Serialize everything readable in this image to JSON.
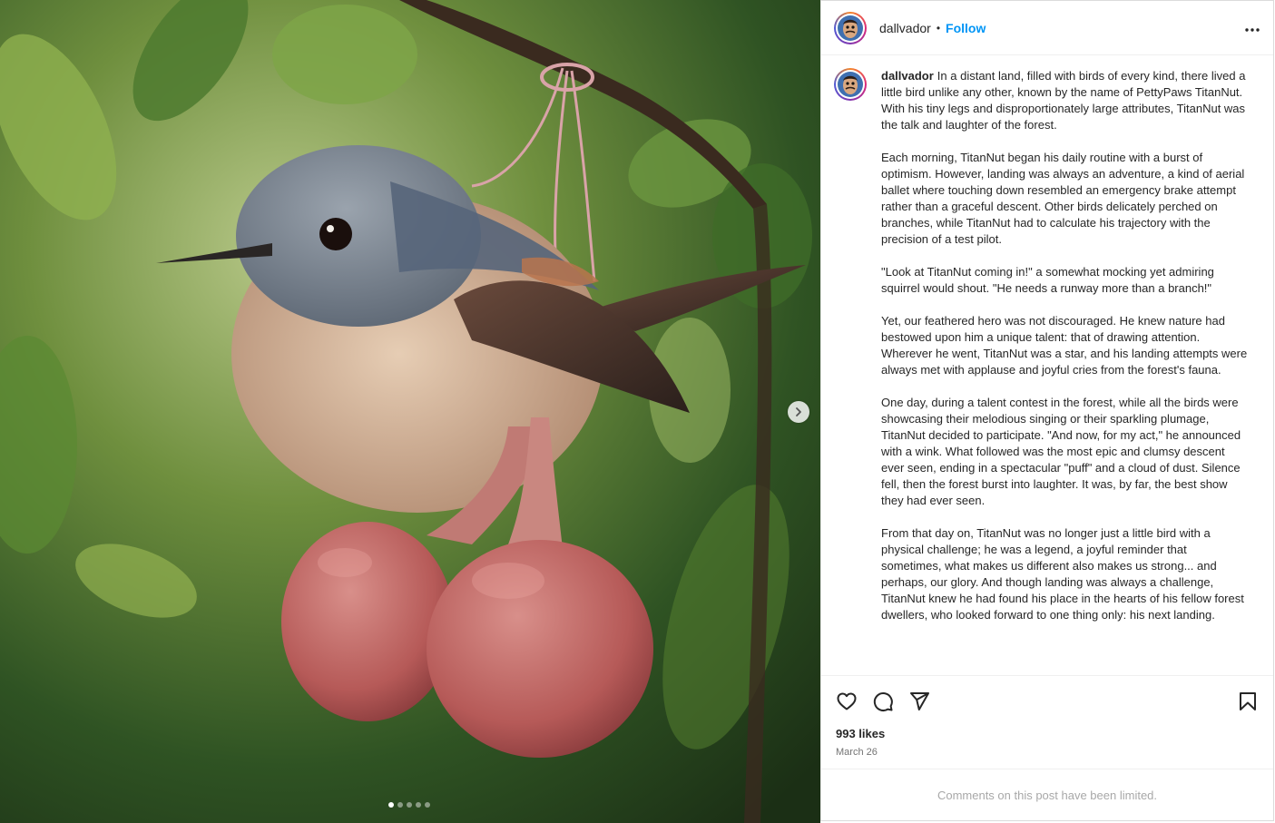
{
  "post": {
    "username": "dallvador",
    "separator": "•",
    "follow_label": "Follow",
    "more_icon": "more-horizontal-icon",
    "image_alt_icons": {
      "next": "chevron-right-icon"
    },
    "carousel": {
      "count": 5,
      "active_index": 0
    }
  },
  "caption": {
    "username": "dallvador",
    "paragraphs": [
      "In a distant land, filled with birds of every kind, there lived a little bird unlike any other, known by the name of PettyPaws TitanNut. With his tiny legs and disproportionately large attributes, TitanNut was the talk and laughter of the forest.",
      "Each morning, TitanNut began his daily routine with a burst of optimism. However, landing was always an adventure, a kind of aerial ballet where touching down resembled an emergency brake attempt rather than a graceful descent. Other birds delicately perched on branches, while TitanNut had to calculate his trajectory with the precision of a test pilot.",
      "\"Look at TitanNut coming in!\" a somewhat mocking yet admiring squirrel would shout. \"He needs a runway more than a branch!\"",
      "Yet, our feathered hero was not discouraged. He knew nature had bestowed upon him a unique talent: that of drawing attention. Wherever he went, TitanNut was a star, and his landing attempts were always met with applause and joyful cries from the forest's fauna.",
      "One day, during a talent contest in the forest, while all the birds were showcasing their melodious singing or their sparkling plumage, TitanNut decided to participate. \"And now, for my act,\" he announced with a wink. What followed was the most epic and clumsy descent ever seen, ending in a spectacular \"puff\" and a cloud of dust. Silence fell, then the forest burst into laughter. It was, by far, the best show they had ever seen.",
      "From that day on, TitanNut was no longer just a little bird with a physical challenge; he was a legend, a joyful reminder that sometimes, what makes us different also makes us strong... and perhaps, our glory. And though landing was always a challenge, TitanNut knew he had found his place in the hearts of his fellow forest dwellers, who looked forward to one thing only: his next landing."
    ]
  },
  "actions": {
    "icons": [
      "heart-icon",
      "comment-icon",
      "share-icon",
      "bookmark-icon"
    ]
  },
  "stats": {
    "likes": "993 likes",
    "date": "March 26"
  },
  "comments_notice": "Comments on this post have been limited.",
  "colors": {
    "follow": "#0095f6",
    "muted": "#737373",
    "border": "#dbdbdb"
  }
}
